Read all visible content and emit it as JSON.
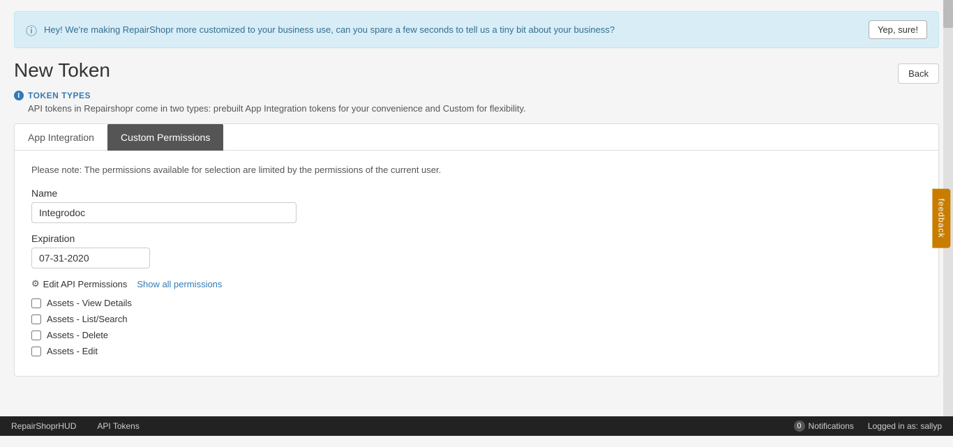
{
  "banner": {
    "text": "Hey! We're making RepairShopr more customized to your business use, can you spare a few seconds to tell us a tiny bit about your business?",
    "button_label": "Yep, sure!"
  },
  "page": {
    "title": "New Token",
    "back_button": "Back"
  },
  "token_types": {
    "label": "TOKEN TYPES",
    "description": "API tokens in Repairshopr come in two types: prebuilt App Integration tokens for your convenience and Custom for flexibility."
  },
  "tabs": [
    {
      "label": "App Integration",
      "active": false
    },
    {
      "label": "Custom Permissions",
      "active": true
    }
  ],
  "form": {
    "permission_note": "Please note: The permissions available for selection are limited by the permissions of the current user.",
    "name_label": "Name",
    "name_value": "Integrodoc",
    "name_placeholder": "",
    "expiration_label": "Expiration",
    "expiration_value": "07-31-2020"
  },
  "permissions": {
    "edit_label": "Edit API Permissions",
    "show_all_label": "Show all permissions",
    "checkboxes": [
      {
        "label": "Assets - View Details",
        "checked": false
      },
      {
        "label": "Assets - List/Search",
        "checked": false
      },
      {
        "label": "Assets - Delete",
        "checked": false
      },
      {
        "label": "Assets - Edit",
        "checked": false
      }
    ]
  },
  "feedback": {
    "label": "feedback"
  },
  "bottom_bar": {
    "app_name": "RepairShoprHUD",
    "section": "API Tokens",
    "notifications_count": "0",
    "notifications_label": "Notifications",
    "logged_in_label": "Logged in as: sallyp"
  }
}
